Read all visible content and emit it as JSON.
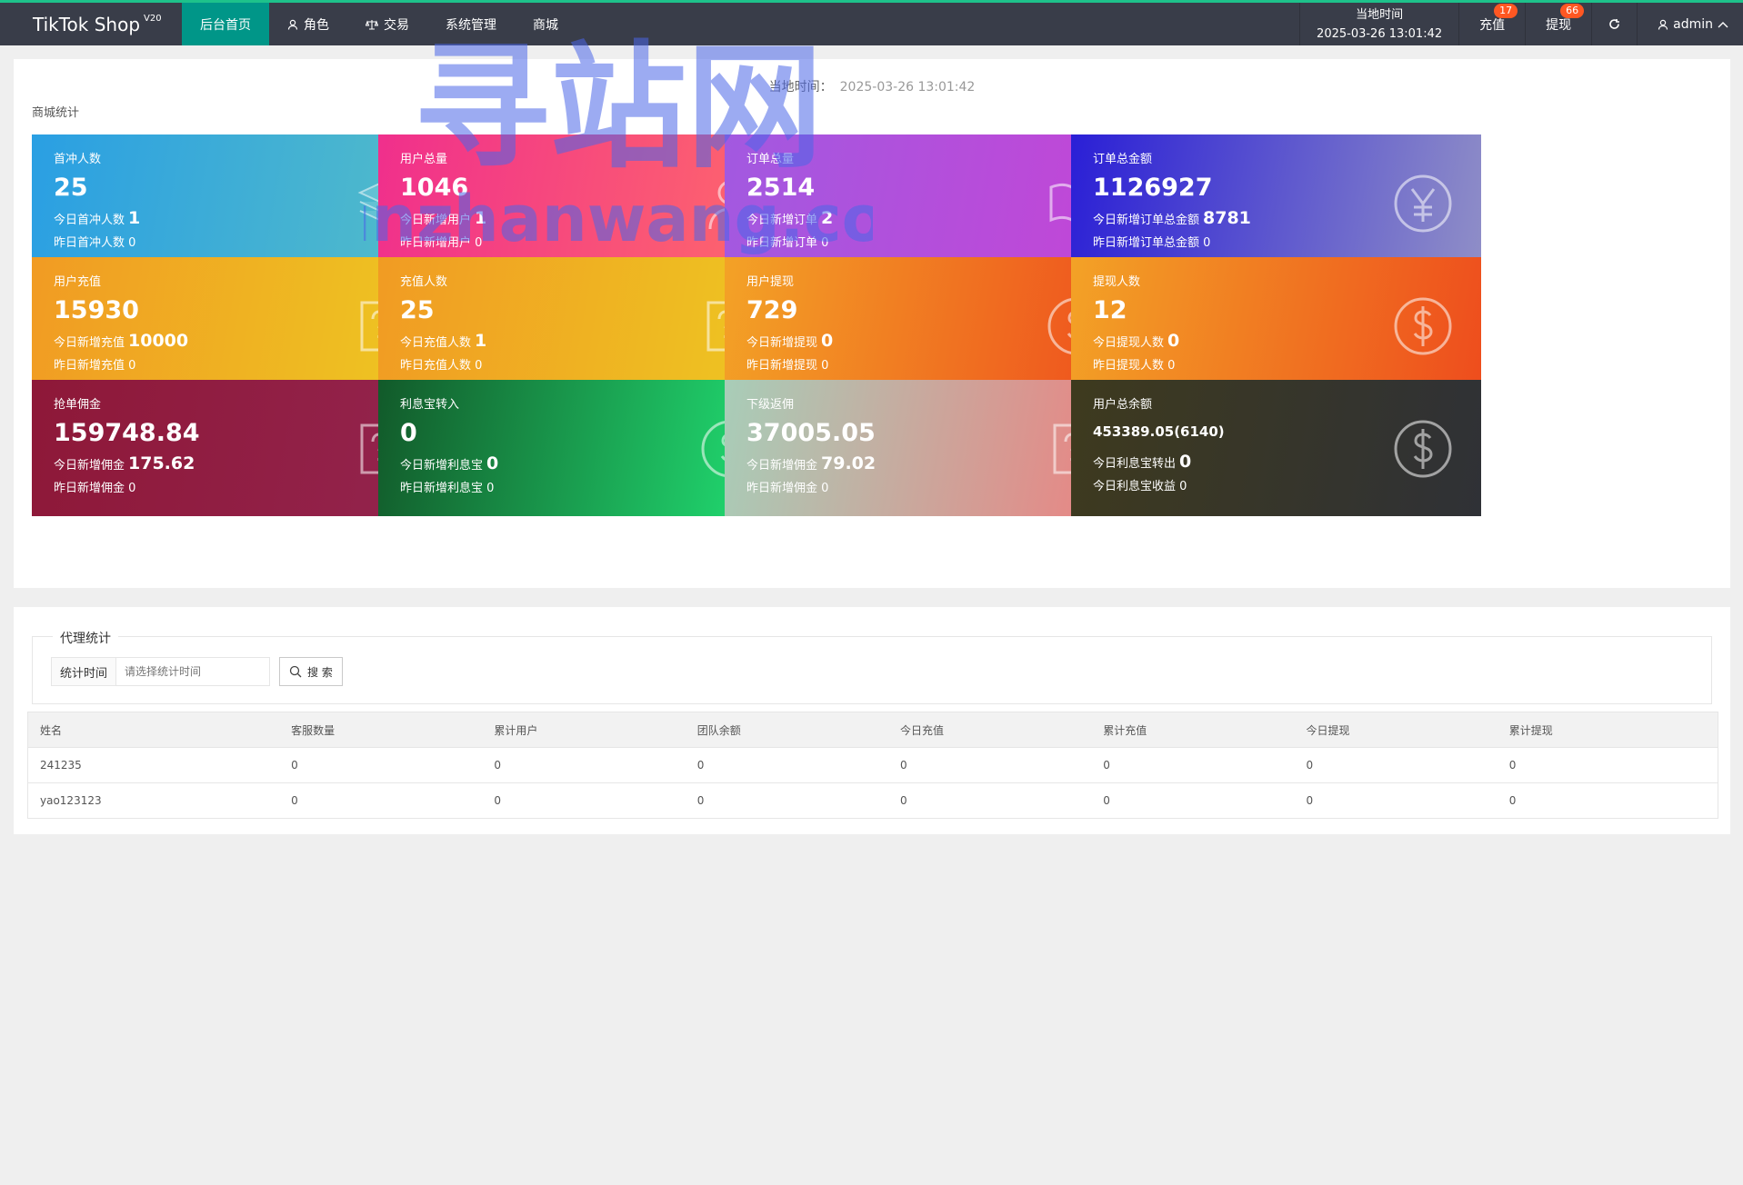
{
  "brand": {
    "name": "TikTok Shop",
    "version": "V20"
  },
  "nav": [
    {
      "label": "后台首页",
      "icon": ""
    },
    {
      "label": "角色",
      "icon": "user-icon"
    },
    {
      "label": "交易",
      "icon": "scale-icon"
    },
    {
      "label": "系统管理",
      "icon": ""
    },
    {
      "label": "商城",
      "icon": ""
    }
  ],
  "header": {
    "clock_title": "当地时间",
    "clock_value": "2025-03-26 13:01:42",
    "recharge_label": "充值",
    "recharge_badge": "17",
    "withdraw_label": "提现",
    "withdraw_badge": "66",
    "refresh_icon": "refresh-icon",
    "user_label": "admin"
  },
  "stats_card": {
    "time_label": "当地时间：",
    "time_value": "2025-03-26 13:01:42",
    "title": "商城统计"
  },
  "stats": [
    {
      "label": "首冲人数",
      "value": "25",
      "line2_label": "今日首冲人数",
      "line2_value": "1",
      "line3": "昨日首冲人数 0",
      "icon": "layers-icon",
      "gradient": [
        "#2a9fe3",
        "#54bdc8"
      ]
    },
    {
      "label": "用户总量",
      "value": "1046",
      "line2_label": "今日新增用户",
      "line2_value": "1",
      "line3": "昨日新增用户 0",
      "icon": "user-icon",
      "gradient": [
        "#f02f8c",
        "#ff6a6a"
      ]
    },
    {
      "label": "订单总量",
      "value": "2514",
      "line2_label": "今日新增订单",
      "line2_value": "2",
      "line3": "昨日新增订单 0",
      "icon": "book-icon",
      "gradient": [
        "#a259e0",
        "#c445d6"
      ]
    },
    {
      "label": "订单总金额",
      "value": "1126927",
      "line2_label": "今日新增订单总金额",
      "line2_value": "8781",
      "line3": "昨日新增订单总金额 0",
      "icon": "yen-icon",
      "gradient": [
        "#2a1fd6",
        "#8f8ec7"
      ]
    },
    {
      "label": "用户充值",
      "value": "15930",
      "line2_label": "今日新增充值",
      "line2_value": "10000",
      "line3": "昨日新增充值 0",
      "icon": "edit-question-icon",
      "gradient": [
        "#f19b23",
        "#edc822"
      ]
    },
    {
      "label": "充值人数",
      "value": "25",
      "line2_label": "今日充值人数",
      "line2_value": "1",
      "line3": "昨日充值人数 0",
      "icon": "edit-question-icon",
      "gradient": [
        "#f19b23",
        "#edc822"
      ]
    },
    {
      "label": "用户提现",
      "value": "729",
      "line2_label": "今日新增提现",
      "line2_value": "0",
      "line3": "昨日新增提现 0",
      "icon": "dollar-icon",
      "gradient": [
        "#f3a226",
        "#ee4d1d"
      ]
    },
    {
      "label": "提现人数",
      "value": "12",
      "line2_label": "今日提现人数",
      "line2_value": "0",
      "line3": "昨日提现人数 0",
      "icon": "dollar-icon",
      "gradient": [
        "#f3a226",
        "#ee4d1d"
      ]
    },
    {
      "label": "抢单佣金",
      "value": "159748.84",
      "line2_label": "今日新增佣金",
      "line2_value": "175.62",
      "line3": "昨日新增佣金 0",
      "icon": "edit-question-icon",
      "gradient": [
        "#8e1838",
        "#93244e"
      ]
    },
    {
      "label": "利息宝转入",
      "value": "0",
      "line2_label": "今日新增利息宝",
      "line2_value": "0",
      "line3": "昨日新增利息宝 0",
      "icon": "dollar-icon",
      "gradient": [
        "#125a2a",
        "#22e476"
      ]
    },
    {
      "label": "下级返佣",
      "value": "37005.05",
      "line2_label": "今日新增佣金",
      "line2_value": "79.02",
      "line3": "昨日新增佣金 0",
      "icon": "edit-question-icon",
      "gradient": [
        "#a8cdb8",
        "#ee7f7f"
      ]
    },
    {
      "label": "用户总余额",
      "value": "453389.05(6140)",
      "line2_label": "今日利息宝转出",
      "line2_value": "0",
      "line3": "今日利息宝收益 0",
      "icon": "dollar-icon",
      "gradient": [
        "#3e3a1e",
        "#2f3136"
      ]
    }
  ],
  "agent": {
    "legend": "代理统计",
    "filter_label": "统计时间",
    "filter_placeholder": "请选择统计时间",
    "search_label": "搜 索",
    "columns": [
      "姓名",
      "客服数量",
      "累计用户",
      "团队余额",
      "今日充值",
      "累计充值",
      "今日提现",
      "累计提现"
    ],
    "rows": [
      [
        "241235",
        "0",
        "0",
        "0",
        "0",
        "0",
        "0",
        "0"
      ],
      [
        "yao123123",
        "0",
        "0",
        "0",
        "0",
        "0",
        "0",
        "0"
      ]
    ]
  },
  "watermark": {
    "top": "寻站网",
    "bottom": "xunzhanwang.com"
  }
}
